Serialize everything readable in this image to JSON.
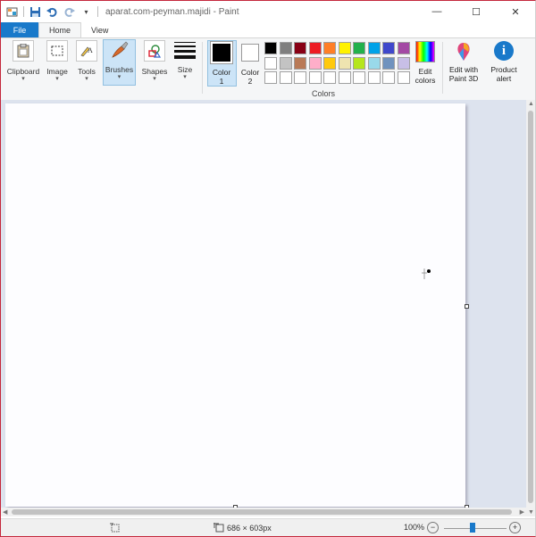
{
  "window": {
    "title": "aparat.com-peyman.majidi - Paint",
    "buttons": {
      "minimize": "—",
      "maximize": "☐",
      "close": "✕"
    }
  },
  "quick_access": [
    "paint-app-icon",
    "save-icon",
    "undo-icon",
    "redo-icon",
    "customize-dropdown-icon"
  ],
  "tabs": {
    "file": "File",
    "home": "Home",
    "view": "View"
  },
  "ribbon": {
    "clipboard": "Clipboard",
    "image": "Image",
    "tools": "Tools",
    "brushes": "Brushes",
    "shapes": "Shapes",
    "size": "Size",
    "color1_line1": "Color",
    "color1_line2": "1",
    "color2_line1": "Color",
    "color2_line2": "2",
    "edit_colors_line1": "Edit",
    "edit_colors_line2": "colors",
    "paint3d_line1": "Edit with",
    "paint3d_line2": "Paint 3D",
    "product_alert_line1": "Product",
    "product_alert_line2": "alert",
    "colors_group": "Colors",
    "color1_value": "#000000",
    "color2_value": "#ffffff",
    "palette_row1": [
      "#000000",
      "#7f7f7f",
      "#880015",
      "#ed1c24",
      "#ff7f27",
      "#fff200",
      "#22b14c",
      "#00a2e8",
      "#3f48cc",
      "#a349a4"
    ],
    "palette_row2": [
      "#ffffff",
      "#c3c3c3",
      "#b97a57",
      "#ffaec9",
      "#ffc90e",
      "#efe4b0",
      "#b5e61d",
      "#99d9ea",
      "#7092be",
      "#c8bfe7"
    ],
    "palette_row3": [
      "#ffffff",
      "#ffffff",
      "#ffffff",
      "#ffffff",
      "#ffffff",
      "#ffffff",
      "#ffffff",
      "#ffffff",
      "#ffffff",
      "#ffffff"
    ]
  },
  "status": {
    "canvas_size": "686 × 603px",
    "zoom": "100%",
    "zoom_out": "−",
    "zoom_in": "+"
  }
}
